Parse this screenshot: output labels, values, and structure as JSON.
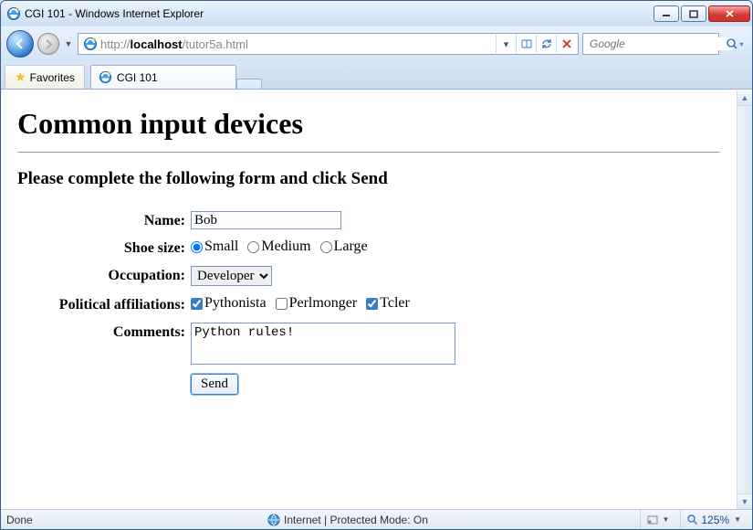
{
  "window": {
    "title": "CGI 101 - Windows Internet Explorer"
  },
  "address": {
    "scheme": "http://",
    "host": "localhost",
    "path": "/tutor5a.html"
  },
  "search": {
    "placeholder": "Google"
  },
  "favorites": {
    "label": "Favorites"
  },
  "tab": {
    "title": "CGI 101"
  },
  "page": {
    "heading": "Common input devices",
    "subheading": "Please complete the following form and click Send",
    "labels": {
      "name": "Name:",
      "shoe": "Shoe size:",
      "occupation": "Occupation:",
      "political": "Political affiliations:",
      "comments": "Comments:"
    },
    "form": {
      "name": "Bob",
      "shoe_options": [
        "Small",
        "Medium",
        "Large"
      ],
      "shoe_selected": "Small",
      "occupation_selected": "Developer",
      "political_options": [
        {
          "label": "Pythonista",
          "checked": true
        },
        {
          "label": "Perlmonger",
          "checked": false
        },
        {
          "label": "Tcler",
          "checked": true
        }
      ],
      "comments": "Python rules!",
      "submit": "Send"
    }
  },
  "status": {
    "left": "Done",
    "zone": "Internet | Protected Mode: On",
    "zoom": "125%"
  }
}
